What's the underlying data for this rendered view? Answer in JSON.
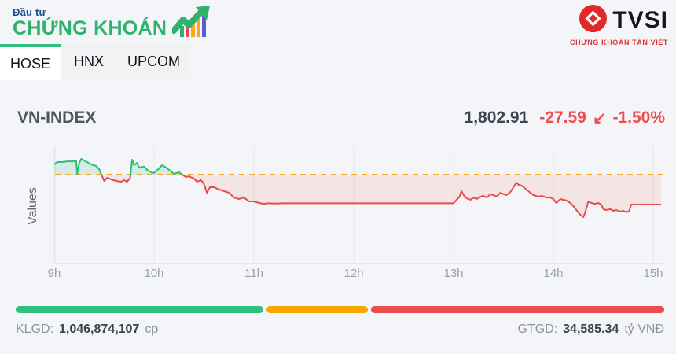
{
  "header": {
    "logo_line1": "Đầu tư",
    "logo_line2": "CHỨNG KHOÁN",
    "brand_name": "TVSI",
    "brand_tagline": "CHỨNG KHOÁN TÂN VIỆT"
  },
  "tabs": [
    {
      "label": "HOSE",
      "active": true
    },
    {
      "label": "HNX",
      "active": false
    },
    {
      "label": "UPCOM",
      "active": false
    }
  ],
  "index": {
    "name": "VN-INDEX",
    "value": "1,802.91",
    "change_abs": "-27.59",
    "change_arrow": "↙",
    "change_pct": "-1.50%"
  },
  "chart_data": {
    "type": "line",
    "title": "VN-INDEX intraday",
    "ylabel": "Values",
    "xlabel": "",
    "x_ticks": [
      "9h",
      "10h",
      "11h",
      "12h",
      "13h",
      "14h",
      "15h"
    ],
    "x_range_hours": [
      9.0,
      15.1
    ],
    "reference_value": 1830.5,
    "close_value": 1802.91,
    "ylim": [
      1752,
      1858
    ],
    "grid": "vertical-only",
    "legend": "none",
    "colors": {
      "above_line": "#2ebd77",
      "above_fill": "rgba(57,188,125,0.16)",
      "below_line": "#ea4b4b",
      "below_fill": "rgba(234,75,75,0.10)",
      "reference_line": "#f7a823",
      "gridline": "#e4e6e9",
      "axis": "#d8dbe0",
      "tick_text": "#9aa0a9"
    },
    "series": [
      {
        "name": "VN-INDEX",
        "points": [
          [
            9.0,
            1839.9
          ],
          [
            9.03,
            1842.1
          ],
          [
            9.08,
            1842.1
          ],
          [
            9.13,
            1842.8
          ],
          [
            9.18,
            1842.8
          ],
          [
            9.22,
            1843.2
          ],
          [
            9.23,
            1831.2
          ],
          [
            9.25,
            1841.4
          ],
          [
            9.27,
            1845.0
          ],
          [
            9.3,
            1843.6
          ],
          [
            9.33,
            1842.1
          ],
          [
            9.37,
            1839.9
          ],
          [
            9.42,
            1838.5
          ],
          [
            9.45,
            1835.6
          ],
          [
            9.48,
            1829.0
          ],
          [
            9.5,
            1824.7
          ],
          [
            9.53,
            1827.6
          ],
          [
            9.57,
            1826.1
          ],
          [
            9.62,
            1824.7
          ],
          [
            9.67,
            1824.0
          ],
          [
            9.7,
            1825.4
          ],
          [
            9.73,
            1824.0
          ],
          [
            9.76,
            1827.6
          ],
          [
            9.78,
            1844.3
          ],
          [
            9.8,
            1839.2
          ],
          [
            9.83,
            1841.4
          ],
          [
            9.85,
            1837.0
          ],
          [
            9.9,
            1837.8
          ],
          [
            9.93,
            1834.9
          ],
          [
            9.97,
            1832.7
          ],
          [
            10.0,
            1832.0
          ],
          [
            10.05,
            1836.3
          ],
          [
            10.08,
            1839.2
          ],
          [
            10.12,
            1837.0
          ],
          [
            10.17,
            1833.4
          ],
          [
            10.2,
            1831.2
          ],
          [
            10.25,
            1832.7
          ],
          [
            10.28,
            1830.5
          ],
          [
            10.32,
            1828.3
          ],
          [
            10.35,
            1829.0
          ],
          [
            10.4,
            1826.9
          ],
          [
            10.43,
            1824.0
          ],
          [
            10.47,
            1825.4
          ],
          [
            10.5,
            1821.8
          ],
          [
            10.53,
            1813.8
          ],
          [
            10.56,
            1818.9
          ],
          [
            10.6,
            1818.9
          ],
          [
            10.65,
            1816.7
          ],
          [
            10.7,
            1815.3
          ],
          [
            10.75,
            1813.8
          ],
          [
            10.8,
            1809.4
          ],
          [
            10.85,
            1808.0
          ],
          [
            10.9,
            1809.4
          ],
          [
            10.95,
            1805.8
          ],
          [
            11.0,
            1805.8
          ],
          [
            11.05,
            1804.4
          ],
          [
            11.1,
            1803.6
          ],
          [
            11.15,
            1804.2
          ],
          [
            11.2,
            1803.8
          ],
          [
            11.3,
            1804.1
          ],
          [
            12.0,
            1804.1
          ],
          [
            13.0,
            1804.1
          ],
          [
            13.03,
            1807.3
          ],
          [
            13.06,
            1810.2
          ],
          [
            13.08,
            1815.3
          ],
          [
            13.1,
            1811.6
          ],
          [
            13.13,
            1808.7
          ],
          [
            13.17,
            1807.3
          ],
          [
            13.2,
            1809.4
          ],
          [
            13.23,
            1808.0
          ],
          [
            13.27,
            1810.2
          ],
          [
            13.3,
            1810.9
          ],
          [
            13.33,
            1809.4
          ],
          [
            13.37,
            1812.4
          ],
          [
            13.4,
            1811.6
          ],
          [
            13.43,
            1810.2
          ],
          [
            13.47,
            1813.8
          ],
          [
            13.5,
            1812.4
          ],
          [
            13.53,
            1811.6
          ],
          [
            13.57,
            1814.5
          ],
          [
            13.6,
            1818.9
          ],
          [
            13.63,
            1823.2
          ],
          [
            13.65,
            1821.1
          ],
          [
            13.68,
            1820.4
          ],
          [
            13.72,
            1817.4
          ],
          [
            13.77,
            1813.8
          ],
          [
            13.8,
            1811.6
          ],
          [
            13.85,
            1810.2
          ],
          [
            13.88,
            1810.9
          ],
          [
            13.93,
            1809.4
          ],
          [
            13.97,
            1809.4
          ],
          [
            14.0,
            1808.0
          ],
          [
            14.03,
            1804.4
          ],
          [
            14.07,
            1808.0
          ],
          [
            14.1,
            1807.3
          ],
          [
            14.13,
            1806.6
          ],
          [
            14.17,
            1804.4
          ],
          [
            14.2,
            1801.5
          ],
          [
            14.23,
            1797.8
          ],
          [
            14.27,
            1793.5
          ],
          [
            14.3,
            1791.3
          ],
          [
            14.32,
            1795.7
          ],
          [
            14.35,
            1805.8
          ],
          [
            14.38,
            1804.4
          ],
          [
            14.42,
            1803.6
          ],
          [
            14.45,
            1804.4
          ],
          [
            14.48,
            1802.9
          ],
          [
            14.5,
            1798.6
          ],
          [
            14.53,
            1797.8
          ],
          [
            14.57,
            1798.6
          ],
          [
            14.6,
            1797.1
          ],
          [
            14.63,
            1797.8
          ],
          [
            14.67,
            1796.4
          ],
          [
            14.7,
            1797.1
          ],
          [
            14.73,
            1795.7
          ],
          [
            14.76,
            1797.1
          ],
          [
            14.78,
            1802.9
          ],
          [
            14.9,
            1802.9
          ],
          [
            15.08,
            1802.9
          ]
        ]
      }
    ]
  },
  "footer": {
    "bar_segments": [
      {
        "name": "advancers",
        "color": "#2fbf7f",
        "pct": 38.2
      },
      {
        "name": "unchanged",
        "color": "#f7a800",
        "pct": 15.6
      },
      {
        "name": "decliners",
        "color": "#ea4d4d",
        "pct": 45.2
      }
    ],
    "klgd_label": "KLGD:",
    "klgd_value": "1,046,874,107",
    "klgd_unit": "cp",
    "gtgd_label": "GTGD:",
    "gtgd_value": "34,585.34",
    "gtgd_unit": "tỷ VNĐ"
  }
}
